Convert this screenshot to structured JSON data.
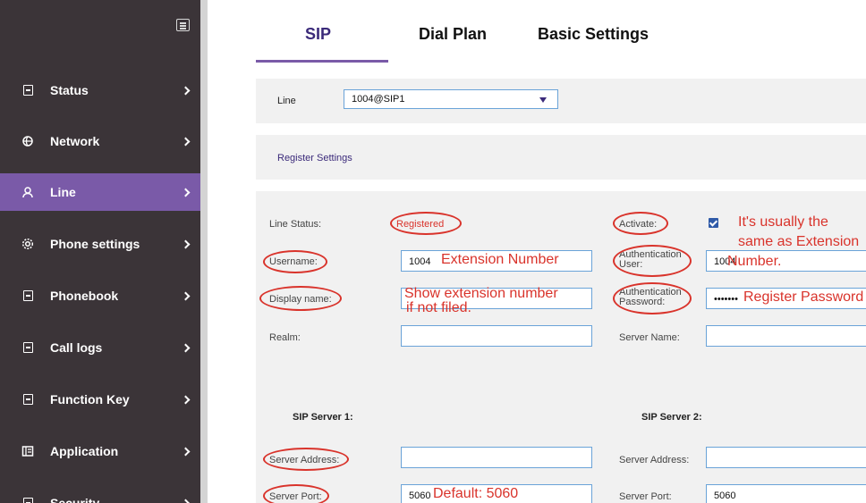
{
  "sidebar": {
    "items": [
      {
        "label": "Status",
        "icon": "document-icon"
      },
      {
        "label": "Network",
        "icon": "network-icon"
      },
      {
        "label": "Line",
        "icon": "user-icon"
      },
      {
        "label": "Phone settings",
        "icon": "settings-icon"
      },
      {
        "label": "Phonebook",
        "icon": "phonebook-icon"
      },
      {
        "label": "Call logs",
        "icon": "call-logs-icon"
      },
      {
        "label": "Function Key",
        "icon": "function-key-icon"
      },
      {
        "label": "Application",
        "icon": "application-icon"
      },
      {
        "label": "Security",
        "icon": "security-icon"
      }
    ],
    "active": "Line"
  },
  "tabs": [
    "SIP",
    "Dial Plan",
    "Basic Settings"
  ],
  "line": {
    "label": "Line",
    "value": "1004@SIP1"
  },
  "register_settings": {
    "title": "Register Settings"
  },
  "form": {
    "line_status_label": "Line Status:",
    "line_status_value": "Registered",
    "activate_label": "Activate:",
    "username_label": "Username:",
    "username_value": "1004",
    "auth_user_label": "Authentication User:",
    "auth_user_value": "1004",
    "display_name_label": "Display name:",
    "display_name_value": "",
    "auth_password_label": "Authentication Password:",
    "auth_password_value": "•••••••",
    "realm_label": "Realm:",
    "server_name_label": "Server Name:",
    "sip_server1_title": "SIP Server 1:",
    "sip_server2_title": "SIP Server 2:",
    "server_address_label": "Server Address:",
    "server_address2_label": "Server Address:",
    "server_port_label": "Server Port:",
    "server_port_value": "5060",
    "server_port2_label": "Server Port:",
    "server_port2_value": "5060"
  },
  "annotations": {
    "extension_number": "Extension Number",
    "show_extension": "Show extension number",
    "show_extension_2": "if not filed.",
    "usually_same_1": "It's usually the",
    "usually_same_2": "same as Extension",
    "usually_same_3": "Number.",
    "register_password": "Register Password",
    "default_port": "Default: 5060"
  },
  "colors": {
    "sidebar": "#3b3438",
    "active": "#7a5aa8",
    "annotation": "#d9332b"
  }
}
